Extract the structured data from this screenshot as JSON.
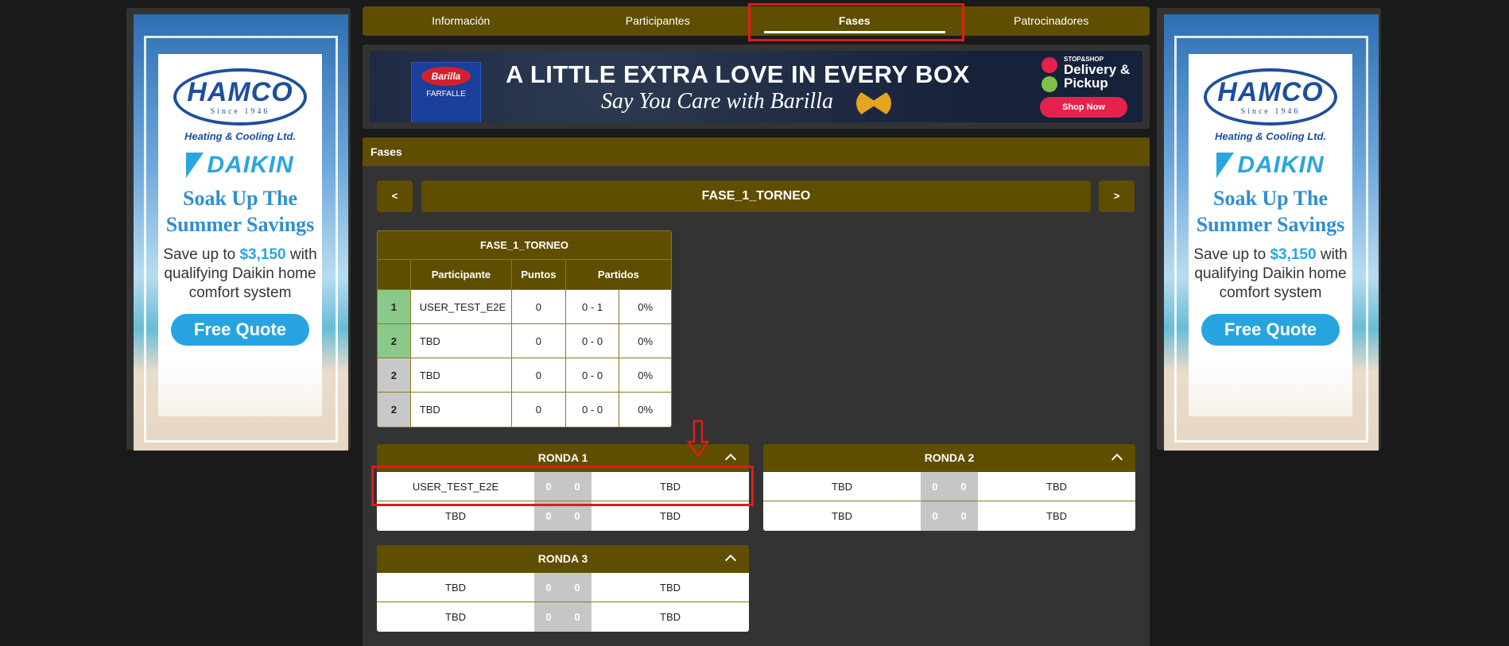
{
  "tabs": [
    {
      "label": "Información",
      "active": false
    },
    {
      "label": "Participantes",
      "active": false
    },
    {
      "label": "Fases",
      "active": true
    },
    {
      "label": "Patrocinadores",
      "active": false
    }
  ],
  "side_ad": {
    "brand": "HAMCO",
    "since": "Since 1946",
    "tagline": "Heating & Cooling Ltd.",
    "partner": "DAIKIN",
    "headline": "Soak Up The Summer Savings",
    "save_prefix": "Save up to",
    "save_amount": "$3,150",
    "save_rest": "with qualifying Daikin home comfort system",
    "cta": "Free Quote"
  },
  "banner": {
    "product_brand": "Barilla",
    "product_name": "FARFALLE",
    "title": "A LITTLE EXTRA LOVE IN EVERY BOX",
    "subtitle": "Say You Care with Barilla",
    "store_brand": "STOP&SHOP",
    "store_service": "Delivery & Pickup",
    "cta": "Shop Now"
  },
  "fases": {
    "header": "Fases",
    "prev_label": "<",
    "next_label": ">",
    "phase_title": "FASE_1_TORNEO",
    "standings": {
      "title": "FASE_1_TORNEO",
      "columns": {
        "participant": "Participante",
        "points": "Puntos",
        "matches": "Partidos"
      },
      "rows": [
        {
          "pos": "1",
          "name": "USER_TEST_E2E",
          "points": "0",
          "record": "0 - 1",
          "pct": "0%"
        },
        {
          "pos": "2",
          "name": "TBD",
          "points": "0",
          "record": "0 - 0",
          "pct": "0%"
        },
        {
          "pos": "2",
          "name": "TBD",
          "points": "0",
          "record": "0 - 0",
          "pct": "0%"
        },
        {
          "pos": "2",
          "name": "TBD",
          "points": "0",
          "record": "0 - 0",
          "pct": "0%"
        }
      ]
    },
    "rounds": [
      {
        "title": "RONDA 1",
        "matches": [
          {
            "home": "USER_TEST_E2E",
            "home_score": "0",
            "away_score": "0",
            "away": "TBD"
          },
          {
            "home": "TBD",
            "home_score": "0",
            "away_score": "0",
            "away": "TBD"
          }
        ]
      },
      {
        "title": "RONDA 2",
        "matches": [
          {
            "home": "TBD",
            "home_score": "0",
            "away_score": "0",
            "away": "TBD"
          },
          {
            "home": "TBD",
            "home_score": "0",
            "away_score": "0",
            "away": "TBD"
          }
        ]
      },
      {
        "title": "RONDA 3",
        "matches": [
          {
            "home": "TBD",
            "home_score": "0",
            "away_score": "0",
            "away": "TBD"
          },
          {
            "home": "TBD",
            "home_score": "0",
            "away_score": "0",
            "away": "TBD"
          }
        ]
      }
    ]
  },
  "colors": {
    "primary": "#5f4e00",
    "panel": "#333333",
    "background": "#1a1a1a",
    "highlight": "#e01b1b",
    "pos_first": "#8bc98b",
    "pos_other": "#c8c8c8"
  }
}
